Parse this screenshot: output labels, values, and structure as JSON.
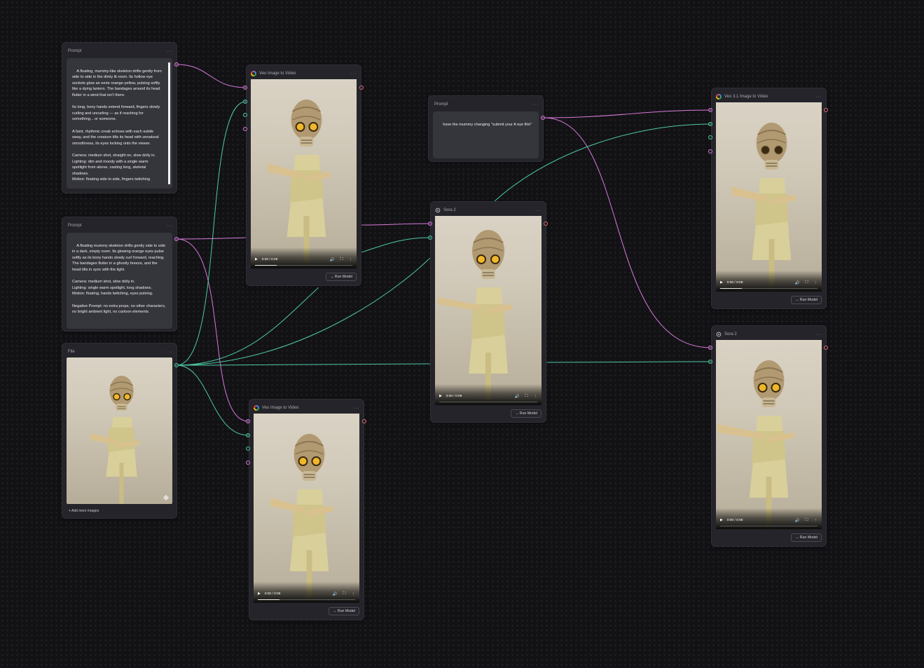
{
  "canvas": {
    "background": "#121215",
    "wire_prompt_color": "#d97ad9",
    "wire_image_color": "#4fc9a3",
    "output_port_color": "#e0707a"
  },
  "nodes": {
    "prompt_1": {
      "title": "Prompt",
      "menu": "···",
      "text": "A floating, mummy-like skeleton drifts gently from side to side in the dimly lit room. Its hollow eye sockets glow an eerie orange-yellow, pulsing softly like a dying lantern. The bandages around its head flutter in a wind that isn't there.\n\nIts long, bony hands extend forward, fingers slowly curling and uncurling — as if reaching for something... or someone.\n\nA faint, rhythmic creak echoes with each subtle sway, and the creature tilts its head with unnatural smoothness, its eyes locking onto the viewer.\n\nCamera: medium shot, straight on, slow dolly in.\nLighting: dim and moody with a single warm spotlight from above, casting long, skeletal shadows.\nMotion: floating side to side, fingers twitching"
    },
    "prompt_2": {
      "title": "Prompt",
      "menu": "···",
      "text": "A floating mummy skeleton drifts gently side to side in a dark, empty room. Its glowing orange eyes pulse softly as its bony hands slowly curl forward, reaching. The bandages flutter in a ghostly breeze, and the head tilts in sync with the light.\n\nCamera: medium shot, slow dolly in.\nLighting: single warm spotlight, long shadows.\nMotion: floating, hands twitching, eyes pulsing.\n\nNegative Prompt: no extra props, no other characters, no bright ambient light, no cartoon elements."
    },
    "file": {
      "title": "File",
      "menu": "···",
      "add_images": "+ Add more images"
    },
    "veo_1": {
      "title": "Veo Image to Video",
      "menu": "···",
      "time": "0:00 / 0:08",
      "run": "→ Run Model",
      "progress": 0.22
    },
    "veo_2": {
      "title": "Veo Image to Video",
      "menu": "···",
      "time": "0:00 / 0:08",
      "run": "→ Run Model",
      "progress": 0.22
    },
    "prompt_3": {
      "title": "Prompt",
      "menu": "···",
      "text": "have the mummy changing \"submit your A eye film\""
    },
    "sora_1": {
      "title": "Sora 2",
      "menu": "···",
      "time": "0:00 / 0:08",
      "run": "→ Run Model",
      "progress": 0
    },
    "veo31": {
      "title": "Veo 3.1 Image to Video",
      "menu": "···",
      "time": "0:00 / 0:08",
      "run": "→ Run Model",
      "progress": 0.22
    },
    "sora_2": {
      "title": "Sora 2",
      "menu": "···",
      "time": "0:00 / 0:08",
      "run": "→ Run Model",
      "progress": 0
    }
  }
}
